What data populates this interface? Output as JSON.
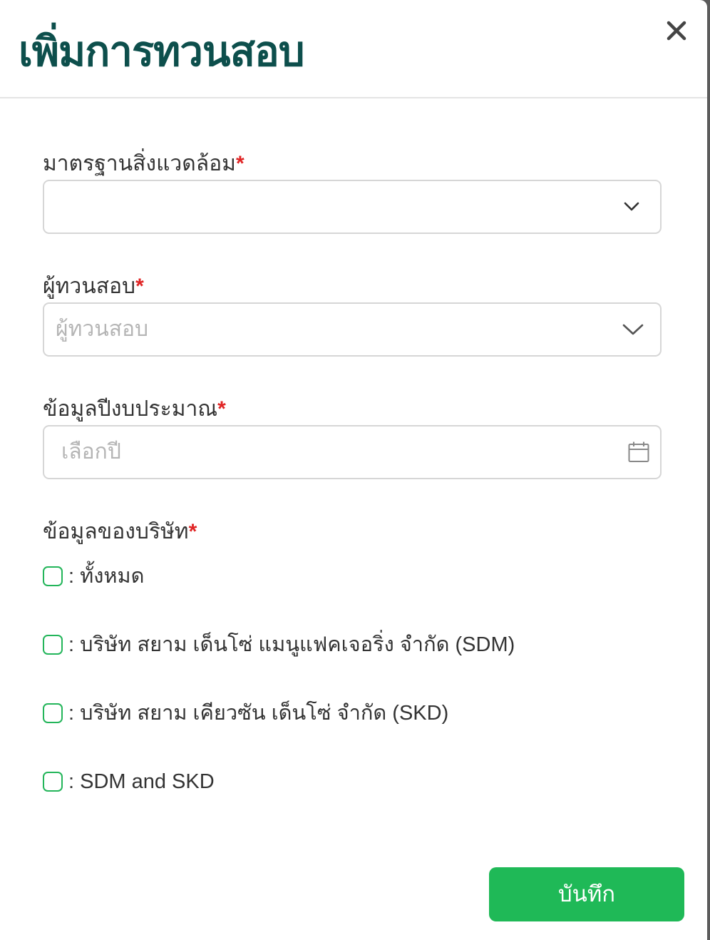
{
  "dialog": {
    "title": "เพิ่มการทวนสอบ",
    "close_icon": "close-icon"
  },
  "form": {
    "env_standard": {
      "label": "มาตรฐานสิ่งแวดล้อม",
      "required_mark": "*",
      "value": ""
    },
    "reviewer": {
      "label": "ผู้ทวนสอบ",
      "required_mark": "*",
      "placeholder": "ผู้ทวนสอบ"
    },
    "budget_year": {
      "label": "ข้อมูลปีงบประมาณ",
      "required_mark": "*",
      "placeholder": "เลือกปี",
      "icon": "calendar-icon"
    },
    "company": {
      "label": "ข้อมูลของบริษัท",
      "required_mark": "*",
      "options": [
        {
          "label": ": ทั้งหมด",
          "checked": false
        },
        {
          "label": ": บริษัท สยาม เด็นโซ่ แมนูแฟคเจอริ่ง จำกัด (SDM)",
          "checked": false
        },
        {
          "label": ": บริษัท สยาม เคียวซัน เด็นโซ่ จำกัด (SKD)",
          "checked": false
        },
        {
          "label": ": SDM and SKD",
          "checked": false
        }
      ]
    }
  },
  "actions": {
    "save_label": "บันทึก"
  },
  "colors": {
    "title": "#0d4f4c",
    "accent": "#1fb957",
    "checkbox_border": "#23b55a",
    "required": "#e02424"
  }
}
